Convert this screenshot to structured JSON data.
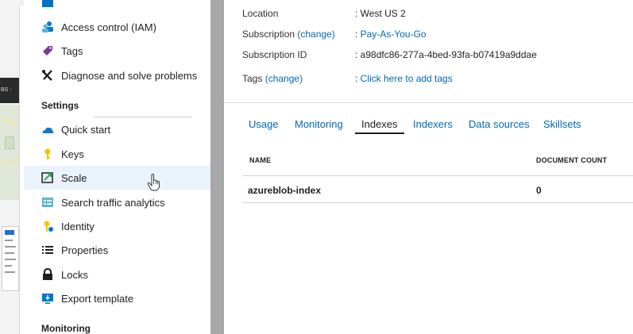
{
  "colors": {
    "link": "#0068b8",
    "selected_row": "#eaf3fb",
    "scrollbar": "#a8a8a8",
    "text": "#1f1f1f"
  },
  "sidebar": {
    "items_top": [
      {
        "label": "Access control (IAM)",
        "icon": "people-icon"
      },
      {
        "label": "Tags",
        "icon": "tag-icon"
      },
      {
        "label": "Diagnose and solve problems",
        "icon": "wrench-icon"
      }
    ],
    "settings_heading": "Settings",
    "settings_items": [
      {
        "label": "Quick start",
        "icon": "cloud-icon"
      },
      {
        "label": "Keys",
        "icon": "key-icon"
      },
      {
        "label": "Scale",
        "icon": "scale-icon",
        "selected": true
      },
      {
        "label": "Search traffic analytics",
        "icon": "analytics-icon"
      },
      {
        "label": "Identity",
        "icon": "identity-key-icon"
      },
      {
        "label": "Properties",
        "icon": "list-icon"
      },
      {
        "label": "Locks",
        "icon": "lock-icon"
      },
      {
        "label": "Export template",
        "icon": "export-icon"
      }
    ],
    "monitoring_heading": "Monitoring"
  },
  "essentials": {
    "location_label": "Location",
    "location_value": ": West US 2",
    "subscription_label": "Subscription",
    "subscription_change": "(change)",
    "subscription_value": "Pay-As-You-Go",
    "subscription_id_label": "Subscription ID",
    "subscription_id_value": ": a98dfc86-277a-4bed-93fa-b07419a9ddae",
    "tags_label": "Tags",
    "tags_change": "(change)",
    "tags_value": "Click here to add tags",
    "colon": ": "
  },
  "tabs": [
    {
      "label": "Usage",
      "active": false
    },
    {
      "label": "Monitoring",
      "active": false
    },
    {
      "label": "Indexes",
      "active": true
    },
    {
      "label": "Indexers",
      "active": false
    },
    {
      "label": "Data sources",
      "active": false
    },
    {
      "label": "Skillsets",
      "active": false
    }
  ],
  "table": {
    "columns": [
      "NAME",
      "DOCUMENT COUNT"
    ],
    "rows": [
      {
        "name": "azureblob-index",
        "document_count": "0"
      }
    ]
  },
  "background_window": {
    "header_fragment": "BS :"
  }
}
